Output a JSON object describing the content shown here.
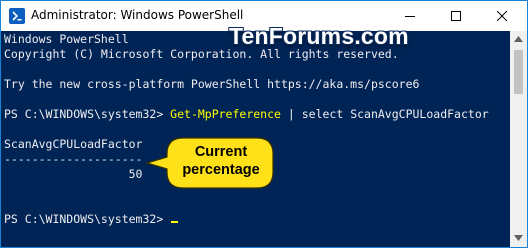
{
  "window": {
    "title": "Administrator: Windows PowerShell",
    "accent_color": "#1883d7",
    "app_icon": "powershell-icon",
    "controls": {
      "minimize_icon": "minimize-icon",
      "maximize_icon": "maximize-icon",
      "close_icon": "close-icon"
    }
  },
  "watermark": "TenForums.com",
  "console": {
    "background_color": "#012456",
    "text_color": "#eeedf0",
    "command_color": "#ffff00",
    "lines": {
      "header1": "Windows PowerShell",
      "header2": "Copyright (C) Microsoft Corporation. All rights reserved.",
      "tip": "Try the new cross-platform PowerShell https://aka.ms/pscore6",
      "prompt1": "PS C:\\WINDOWS\\system32> ",
      "command1": "Get-MpPreference",
      "command1_pipe": " | select ScanAvgCPULoadFactor",
      "column_header": "ScanAvgCPULoadFactor",
      "column_rule": "--------------------",
      "value": "                  50",
      "prompt2": "PS C:\\WINDOWS\\system32> "
    }
  },
  "callout": {
    "line1": "Current",
    "line2": "percentage",
    "fill_color": "#ffe11a"
  },
  "scrollbar": {
    "up_icon": "scroll-up-arrow-icon",
    "down_icon": "scroll-down-arrow-icon"
  }
}
